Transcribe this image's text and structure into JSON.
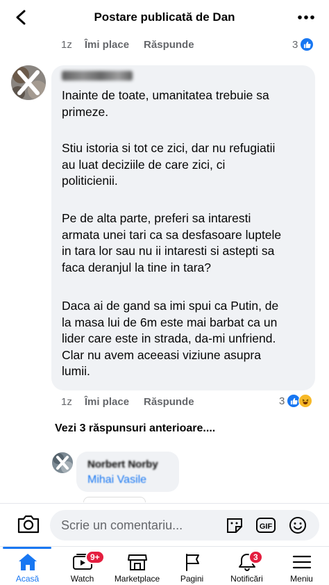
{
  "header": {
    "title": "Postare publicată de Dan"
  },
  "top_actions": {
    "time": "1z",
    "like": "Îmi place",
    "reply": "Răspunde",
    "reaction_count": "3"
  },
  "comment": {
    "paragraphs": [
      "Inainte de toate, umanitatea trebuie sa\nprimeze.",
      "Stiu istoria si tot ce zici, dar nu refugiatii\nau luat deciziile de care zici, ci\npoliticienii.",
      "Pe de alta parte, preferi sa intaresti\narmata unei tari ca sa desfasoare luptele\nin tara lor sau nu ii intaresti si astepti sa\nfaca deranjul la tine in tara?",
      "Daca ai de gand sa imi spui ca Putin, de\nla masa lui de 6m este mai barbat ca un\nlider care este in strada, da-mi unfriend.\nClar nu avem aceeasi viziune asupra\nlumii."
    ],
    "time": "1z",
    "like": "Îmi place",
    "reply": "Răspunde",
    "reaction_count": "3"
  },
  "more_replies": "Vezi 3 răspunsuri anterioare....",
  "reply": {
    "author": "Norbert Norby",
    "text": "Mihai Vasile"
  },
  "composer": {
    "placeholder": "Scrie un comentariu..."
  },
  "nav": {
    "items": [
      {
        "label": "Acasă",
        "icon": "home-icon",
        "active": true
      },
      {
        "label": "Watch",
        "icon": "watch-icon",
        "badge": "9+"
      },
      {
        "label": "Marketplace",
        "icon": "marketplace-icon"
      },
      {
        "label": "Pagini",
        "icon": "pages-flag-icon"
      },
      {
        "label": "Notificări",
        "icon": "bell-icon",
        "badge": "3"
      },
      {
        "label": "Meniu",
        "icon": "menu-icon"
      }
    ]
  },
  "colors": {
    "accent": "#1877f2",
    "badge": "#e41e3f",
    "bubble": "#f0f2f5",
    "muted": "#65676b"
  }
}
